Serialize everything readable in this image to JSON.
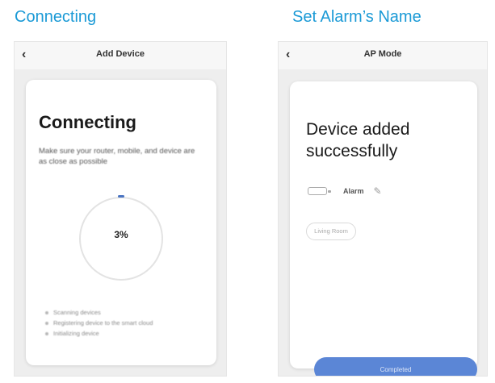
{
  "left_screen": {
    "caption": "Connecting",
    "back_glyph": "‹",
    "title_bar": "Add Device",
    "heading": "Connecting",
    "subtitle": "Make sure your router, mobile, and device are as close as possible",
    "progress_percent": 3,
    "progress_text": "3%",
    "steps": [
      "Scanning devices",
      "Registering device to the smart cloud",
      "Initializing device"
    ]
  },
  "right_screen": {
    "caption": "Set Alarm’s Name",
    "back_glyph": "‹",
    "title_bar": "AP Mode",
    "heading_line1": "Device added",
    "heading_line2": "successfully",
    "device_name": "Alarm",
    "room_chip": "Living Room",
    "done_button": "Completed"
  },
  "icons": {
    "back": "chevron-left-icon",
    "edit": "pencil-icon",
    "device": "alarm-device-icon"
  },
  "colors": {
    "caption": "#1b9ad6",
    "primary_button": "#5b86d6",
    "progress_accent": "#4a74c2"
  }
}
